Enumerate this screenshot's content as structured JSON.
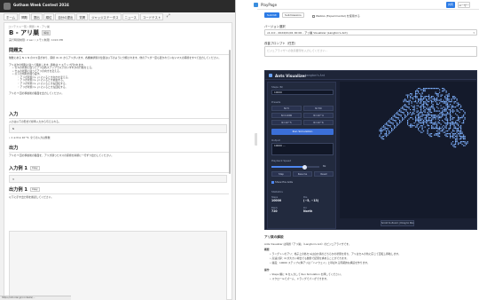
{
  "left": {
    "site_name": "Gotham Week Contest 2024",
    "nav_tabs": [
      "ホーム",
      "問題",
      "提出",
      "順位",
      "自分の提出",
      "質問",
      "ジャッジステータス",
      "ニュース",
      "コードテスト"
    ],
    "crumb": "コンテスト一覧 / 問題 / B - アリ巣",
    "problem_title": "B - アリ巣",
    "title_badge": "解説",
    "meta": "実行時間制限: 2 sec / メモリ制限: 1024 MB",
    "sections": {
      "statement": "問題文",
      "input": "入力",
      "output": "出力",
      "sample_in": "入力例 1",
      "sample_out": "出力例 1"
    },
    "statement_para": "無数にある N × N のマス目があり、座標 (0, 0) からアリがいます。各機械状態の位置は以下のように分類されます。他のアリが一度も置かれていないマスの座標をすべて出力してください。",
    "statement_para2": "アリは次の規則に従って移動します。移動は T ステップ行われます。",
    "bullets": [
      "セルの状態に従ってアリは各ステップで以下のいずれかの行動をとる。",
      "セルの状態に従ってアリの向きを変える。",
      "以下の規則を繰り返す。"
    ],
    "sub_bullets": [
      "アリが状態 (x, y) にいるとき向きを変える。",
      "アリが状態 (x, y) にいるとき前進する。",
      "アリが状態 (x, y) にいるとき右回転する。",
      "アリが状態 (x, y) にいるとき左回転する。"
    ],
    "statement_tail": "アリの T 回の移動後の盤面を出力してください。",
    "input_para": "入力は以下の形式で標準入力から与えられる。",
    "input_code": "N",
    "input_constraint": "• 1 ≤ N ≤ 10^5, 全ての入力は整数",
    "output_para": "アリの T 回の移動後の盤面を、アリが通ったマスの座標を昇順に一行ずつ出力してください。",
    "copy": "Copy",
    "sample_in_value": "3",
    "sample_out_para": "以下に示す出力例を確認してください。",
    "status_url": "https://atcoder.jp/contests/..."
  },
  "right": {
    "page_label": "PlayPage",
    "btn_share": "共有",
    "btn_user": "ユーザー",
    "tool_chips": [
      "Submit",
      "Submissions"
    ],
    "checkbox_label": "WebGL (Experimental) を使用する",
    "version_label": "バージョン選択",
    "version_value": "v1.0.0 - 2024/01/01 00:00 - アリ巣 Visualizer (Langton's Ant)",
    "prompt_label": "改善プロンプト（任意）",
    "prompt_placeholder": "ビジュアライザへの改善要望を入力してください...",
    "viz_title": "Ants Visualizer",
    "viz_subtitle": "Langton's Ant",
    "panel": {
      "steps_label": "Steps (N)",
      "steps_value": "10000",
      "presets_label": "Presets",
      "presets": [
        "N=5",
        "N=50",
        "N=11000",
        "N=10^4",
        "N=10^5",
        "N=10^6"
      ],
      "run_label": "Run Simulation",
      "output_label": "Output",
      "output_value": "10000\n...",
      "speed_label": "Playback Speed",
      "speed_value": "8x",
      "speed_fraction": 0.7,
      "btn_step": "Step",
      "btn_play": "Resume",
      "btn_reset": "Reset",
      "show_label": "Show Pre Ants",
      "stats_label": "Statistics",
      "stat_steps": "10000",
      "stat_steps_label": "Steps",
      "stat_pos": "(−5, −13)",
      "stat_pos_label": "Pos",
      "stat_black": "720",
      "stat_black_label": "Black",
      "stat_dir": "North",
      "stat_dir_label": "Dir"
    },
    "scorebox": "Scroll to Zoom | Drag to Pan",
    "info": {
      "heading": "アリ巣の解説",
      "p1": "Ants Visualizer は問題「アリ巣」（Langton's Ant）のビジュアライザです。",
      "sub1": "概要",
      "items1": [
        "ラングトンのアリ：格子上の各セルは白か黒のどちらかの状態を持ち、アリはセルの色に応じて回転し移動します。",
        "高速計算：N が大きい場合でも数秒で結果を求めることができます。",
        "描画：10000 ステップ以降アリは「ハイウェイ」と呼ばれる周期的な構造を作ります。"
      ],
      "sub2": "操作",
      "items2": [
        "Steps 欄に N を入力して Run Simulation を押してください。",
        "スクロールでズーム、ドラッグでパンができます。"
      ]
    }
  },
  "colors": {
    "accent": "#2c7be5",
    "viz_bg": "#1a2033",
    "cell": "#7fb2ff"
  }
}
